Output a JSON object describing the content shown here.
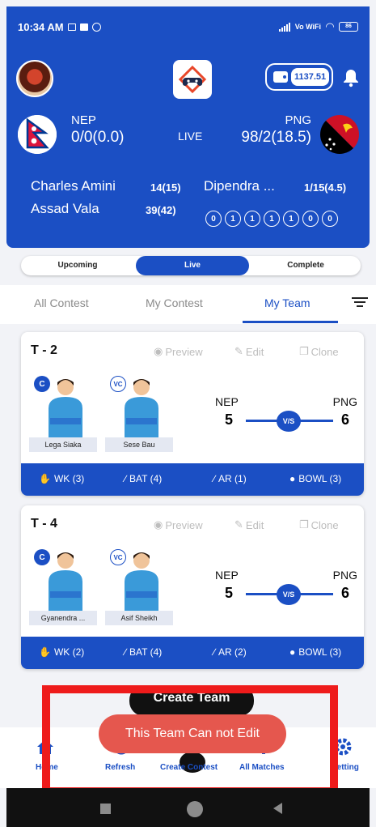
{
  "status_bar": {
    "time": "10:34 AM",
    "network": "Vo WiFi",
    "battery": "86"
  },
  "header": {
    "wallet_amount": "1137.51",
    "match": {
      "team1": {
        "name": "NEP",
        "score": "0/0(0.0)"
      },
      "status": "LIVE",
      "team2": {
        "name": "PNG",
        "score": "98/2(18.5)"
      }
    },
    "batsmen": [
      {
        "name": "Charles Amini",
        "runs": "14(15)"
      },
      {
        "name": "Assad Vala",
        "runs": "39(42)"
      }
    ],
    "bowler": {
      "name": "Dipendra ...",
      "figures": "1/15(4.5)"
    },
    "recent_balls": [
      "0",
      "1",
      "1",
      "1",
      "1",
      "0",
      "0"
    ]
  },
  "segments": [
    {
      "label": "Upcoming",
      "active": false
    },
    {
      "label": "Live",
      "active": true
    },
    {
      "label": "Complete",
      "active": false
    }
  ],
  "contest_tabs": [
    {
      "label": "All Contest",
      "active": false
    },
    {
      "label": "My Contest",
      "active": false
    },
    {
      "label": "My Team",
      "active": true
    }
  ],
  "card_actions": {
    "preview": "Preview",
    "edit": "Edit",
    "clone": "Clone"
  },
  "badges": {
    "captain": "C",
    "vice_captain": "VC"
  },
  "vs_label": "V/S",
  "teams": [
    {
      "title": "T - 2",
      "captain": "Lega Siaka",
      "vice_captain": "Sese Bau",
      "team1": "NEP",
      "team1_count": "5",
      "team2": "PNG",
      "team2_count": "6",
      "wk": "WK (3)",
      "bat": "BAT (4)",
      "ar": "AR (1)",
      "bowl": "BOWL (3)"
    },
    {
      "title": "T - 4",
      "captain": "Gyanendra ...",
      "vice_captain": "Asif Sheikh",
      "team1": "NEP",
      "team1_count": "5",
      "team2": "PNG",
      "team2_count": "6",
      "wk": "WK (2)",
      "bat": "BAT (4)",
      "ar": "AR (2)",
      "bowl": "BOWL (3)"
    }
  ],
  "create_team_label": "Create Team",
  "toast": "This Team Can not Edit",
  "bottom_nav": {
    "home": "Home",
    "refresh": "Refresh",
    "create_contest": "Create Contest",
    "all_matches": "All Matches",
    "setting": "Setting"
  },
  "colors": {
    "primary": "#1b4fc4",
    "toast": "#e5574e",
    "highlight": "#ee1b1b"
  }
}
